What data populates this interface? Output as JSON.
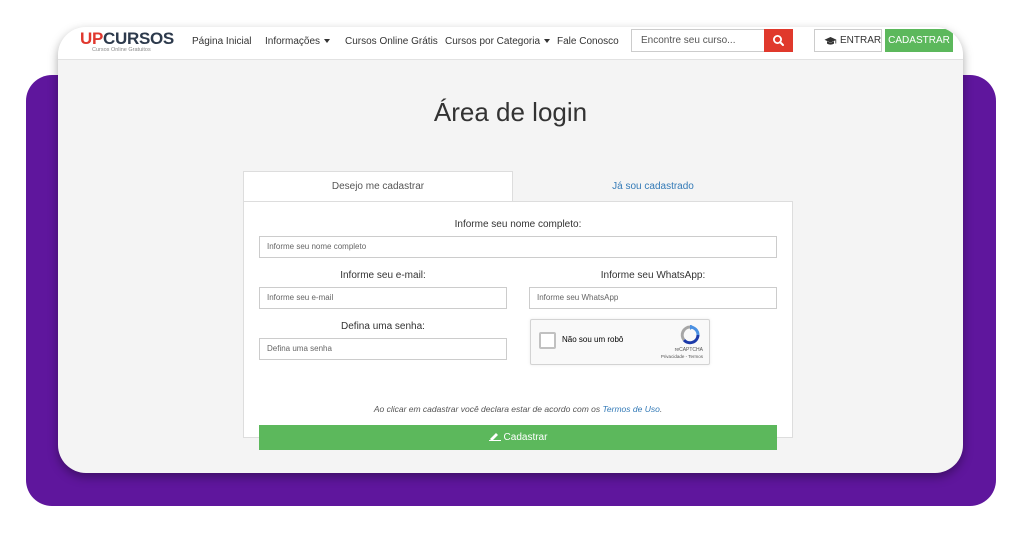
{
  "brand": {
    "logo_up": "UP",
    "logo_cursos": "CURSOS",
    "tagline": "Cursos Online Gratuitos"
  },
  "nav": {
    "links": [
      "Página Inicial",
      "Informações",
      "Cursos Online Grátis",
      "Cursos por Categoria",
      "Fale Conosco"
    ],
    "search_placeholder": "Encontre seu curso...",
    "login_label": "ENTRAR",
    "signup_label": "CADASTRAR"
  },
  "page": {
    "title": "Área de login"
  },
  "tabs": {
    "register": "Desejo me cadastrar",
    "existing": "Já sou cadastrado"
  },
  "form": {
    "name_label": "Informe seu nome completo:",
    "name_placeholder": "Informe seu nome completo",
    "email_label": "Informe seu e-mail:",
    "email_placeholder": "Informe seu e-mail",
    "whatsapp_label": "Informe seu WhatsApp:",
    "whatsapp_placeholder": "Informe seu WhatsApp",
    "password_label": "Defina uma senha:",
    "password_placeholder": "Defina uma senha",
    "captcha_text": "Não sou um robô",
    "captcha_brand": "reCAPTCHA",
    "captcha_terms": "Privacidade - Termos",
    "terms_prefix": "Ao clicar em cadastrar você declara estar de acordo com os ",
    "terms_link": "Termos de Uso",
    "terms_suffix": ".",
    "submit_label": "Cadastrar"
  },
  "colors": {
    "purple": "#5f169d",
    "green": "#5cb85c",
    "red": "#e0392c",
    "link": "#337ab7"
  }
}
